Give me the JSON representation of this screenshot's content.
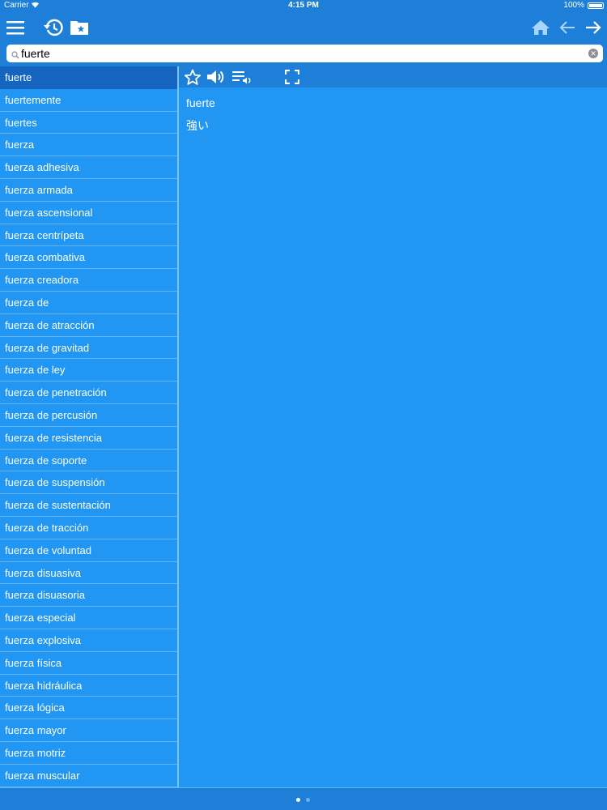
{
  "status": {
    "carrier": "Carrier",
    "time": "4:15 PM",
    "battery": "100%"
  },
  "nav": {
    "menu_icon": "hamburger-menu-icon",
    "history_icon": "history-icon",
    "favorites_icon": "favorites-folder-icon",
    "home_icon": "home-icon",
    "back_icon": "arrow-left-icon",
    "forward_icon": "arrow-right-icon"
  },
  "search": {
    "value": "fuerte",
    "placeholder": ""
  },
  "words": [
    "fuerte",
    "fuertemente",
    "fuertes",
    "fuerza",
    "fuerza adhesiva",
    "fuerza armada",
    "fuerza ascensional",
    "fuerza centrípeta",
    "fuerza combativa",
    "fuerza creadora",
    "fuerza de",
    "fuerza de atracción",
    "fuerza de gravitad",
    "fuerza de ley",
    "fuerza de penetración",
    "fuerza de percusión",
    "fuerza de resistencia",
    "fuerza de soporte",
    "fuerza de suspensión",
    "fuerza de sustentación",
    "fuerza de tracción",
    "fuerza de voluntad",
    "fuerza disuasiva",
    "fuerza disuasoria",
    "fuerza especial",
    "fuerza explosiva",
    "fuerza física",
    "fuerza hidráulica",
    "fuerza lógica",
    "fuerza mayor",
    "fuerza motriz",
    "fuerza muscular"
  ],
  "selected_index": 0,
  "detail": {
    "headword": "fuerte",
    "translation": "強い"
  },
  "toolbar": {
    "favorite_icon": "star-outline-icon",
    "speaker_icon": "speaker-icon",
    "playlist_icon": "playlist-audio-icon",
    "fullscreen_icon": "fullscreen-icon"
  },
  "pager": {
    "pages": 2,
    "current": 0
  },
  "colors": {
    "background": "#2196F3",
    "bar": "#1E7FD8",
    "selected": "#1565C0"
  }
}
